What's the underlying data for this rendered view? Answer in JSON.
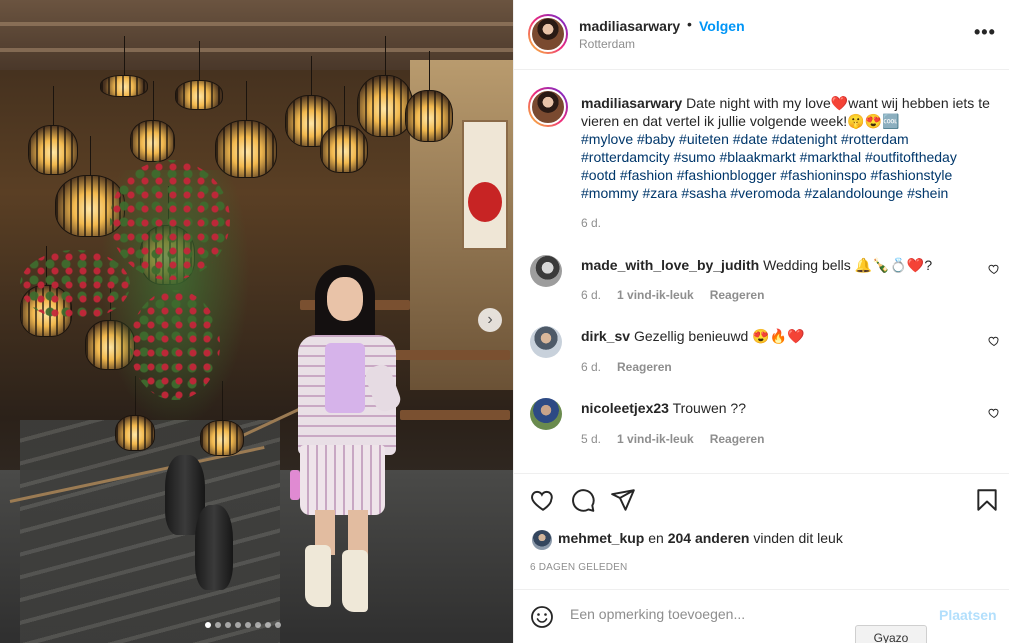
{
  "post": {
    "username": "madiliasarwary",
    "separator": "•",
    "follow_label": "Volgen",
    "location": "Rotterdam",
    "more_label": "•••"
  },
  "caption": {
    "username": "madiliasarwary",
    "text": "Date night with my love❤️want wij hebben iets te vieren en dat vertel ik jullie volgende week!🤫😍🆒",
    "hashtags": "#mylove #baby #uiteten #date #datenight #rotterdam #rotterdamcity #sumo #blaakmarkt #markthal #outfitoftheday #ootd #fashion #fashionblogger #fashioninspo #fashionstyle #mommy #zara #sasha #veromoda #zalandolounge #shein",
    "time": "6 d."
  },
  "comments": [
    {
      "username": "made_with_love_by_judith",
      "text": "Wedding bells 🔔🍾💍❤️?",
      "time": "6 d.",
      "likes": "1 vind-ik-leuk",
      "reply": "Reageren"
    },
    {
      "username": "dirk_sv",
      "text": "Gezellig benieuwd 😍🔥❤️",
      "time": "6 d.",
      "likes": "",
      "reply": "Reageren"
    },
    {
      "username": "nicoleetjex23",
      "text": "Trouwen ??",
      "time": "5 d.",
      "likes": "1 vind-ik-leuk",
      "reply": "Reageren"
    }
  ],
  "likes": {
    "user": "mehmet_kup",
    "connector": "en",
    "others": "204 anderen",
    "suffix": "vinden dit leuk"
  },
  "date": "6 DAGEN GELEDEN",
  "add_comment": {
    "placeholder": "Een opmerking toevoegen...",
    "post_label": "Plaatsen"
  },
  "carousel": {
    "next_label": "›",
    "slide_count": 8,
    "active_slide": 1
  },
  "overlay": {
    "gyazo_label": "Gyazo"
  },
  "colors": {
    "accent": "#0095f6",
    "hashtag": "#00376b",
    "muted": "#8e8e8e",
    "post_disabled": "#b2dffc"
  },
  "icons": [
    "heart-icon",
    "comment-icon",
    "share-icon",
    "bookmark-icon",
    "emoji-icon",
    "more-icon",
    "chevron-right-icon"
  ]
}
